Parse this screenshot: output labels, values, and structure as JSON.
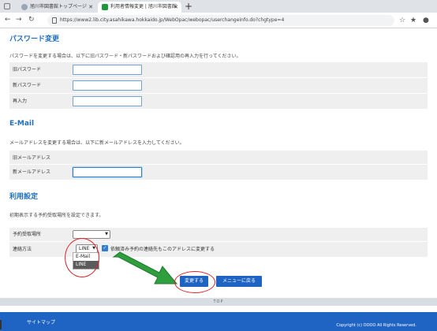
{
  "browser": {
    "tabs": [
      {
        "label": "旭川市図書館トップページ"
      },
      {
        "label": "利用者情報変更 | 旭川市図書館"
      }
    ],
    "new_tab_label": "+",
    "url": "https://www2.lib.city.asahikawa.hokkaido.jp/WebOpac/webopac/userchangeinfo.do?chgtype=4"
  },
  "password_section": {
    "title": "パスワード変更",
    "description": "パスワードを変更する場合は、以下に旧パスワード・新パスワードおよび確認用の再入力を行ってください。",
    "rows": [
      {
        "label": "旧パスワード"
      },
      {
        "label": "新パスワード"
      },
      {
        "label": "再入力"
      }
    ]
  },
  "email_section": {
    "title": "E-Mail",
    "description": "メールアドレスを変更する場合は、以下に新メールアドレスを入力してください。",
    "rows": [
      {
        "label": "旧メールアドレス",
        "value": ""
      },
      {
        "label": "新メールアドレス"
      }
    ]
  },
  "usage_section": {
    "title": "利用設定",
    "description": "初期表示する予約受取場所を設定できます。",
    "pickup_label": "予約受取場所",
    "pickup_value": "",
    "contact_label": "連絡方法",
    "contact_value": "LINE",
    "contact_options": [
      "E-Mail",
      "LINE"
    ],
    "checkbox_label": "依頼済み予約の連絡先もこのアドレスに変更する",
    "checkbox_checked": true
  },
  "buttons": {
    "save": "変更する",
    "menu": "メニューに戻る"
  },
  "footer": {
    "top": "TOP",
    "sitemap": "サイトマップ",
    "copyright": "Copyright (c) OOOO All Rights Reserved."
  },
  "colors": {
    "accent": "#1e6fbf",
    "button": "#1f63c3",
    "annotation_red": "#d9252e",
    "annotation_arrow": "#2e9e3e"
  }
}
